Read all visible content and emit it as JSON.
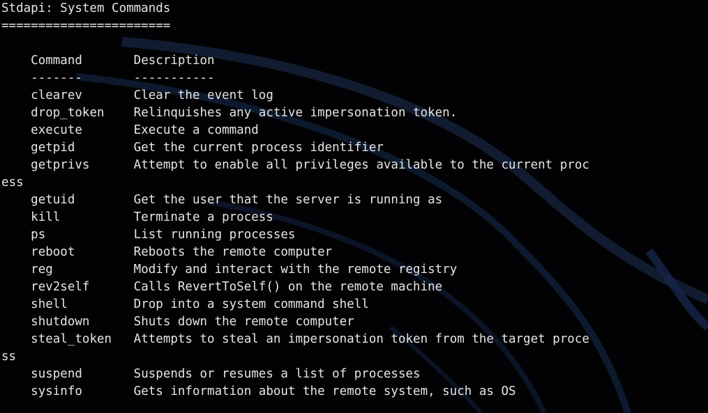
{
  "heading": "Stdapi: System Commands",
  "heading_underline": "=======================",
  "columns": {
    "command": "Command",
    "description": "Description",
    "command_rule": "-------",
    "description_rule": "-----------"
  },
  "rows": [
    {
      "command": "clearev",
      "description": "Clear the event log"
    },
    {
      "command": "drop_token",
      "description": "Relinquishes any active impersonation token."
    },
    {
      "command": "execute",
      "description": "Execute a command"
    },
    {
      "command": "getpid",
      "description": "Get the current process identifier"
    },
    {
      "command": "getprivs",
      "description": "Attempt to enable all privileges available to the current proc",
      "wrap": "ess"
    },
    {
      "command": "getuid",
      "description": "Get the user that the server is running as"
    },
    {
      "command": "kill",
      "description": "Terminate a process"
    },
    {
      "command": "ps",
      "description": "List running processes"
    },
    {
      "command": "reboot",
      "description": "Reboots the remote computer"
    },
    {
      "command": "reg",
      "description": "Modify and interact with the remote registry"
    },
    {
      "command": "rev2self",
      "description": "Calls RevertToSelf() on the remote machine"
    },
    {
      "command": "shell",
      "description": "Drop into a system command shell"
    },
    {
      "command": "shutdown",
      "description": "Shuts down the remote computer"
    },
    {
      "command": "steal_token",
      "description": "Attempts to steal an impersonation token from the target proce",
      "wrap": "ss"
    },
    {
      "command": "suspend",
      "description": "Suspends or resumes a list of processes"
    },
    {
      "command": "sysinfo",
      "description": "Gets information about the remote system, such as OS"
    }
  ],
  "colors": {
    "background": "#020204",
    "text": "#e6e6e6",
    "watermark": "#1a2a4a"
  }
}
